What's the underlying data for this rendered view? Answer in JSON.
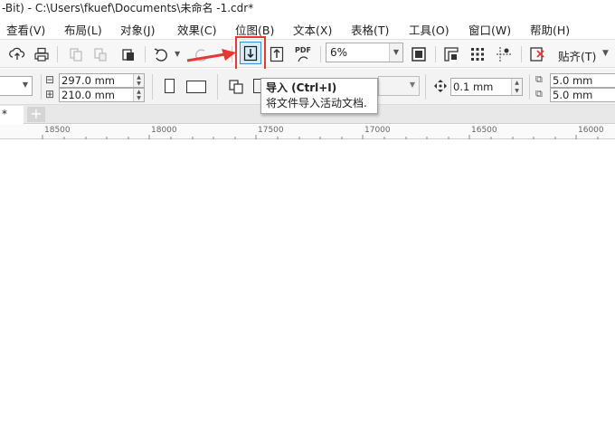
{
  "window": {
    "title": "-Bit) - C:\\Users\\fkuef\\Documents\\未命名 -1.cdr*"
  },
  "menu": {
    "items": [
      "查看(V)",
      "布局(L)",
      "对象(J)",
      "效果(C)",
      "位图(B)",
      "文本(X)",
      "表格(T)",
      "工具(O)",
      "窗口(W)",
      "帮助(H)"
    ]
  },
  "toolbar": {
    "pdf_label": "PDF",
    "zoom_value": "6%",
    "snap_label": "贴齐(T)",
    "icons": [
      "cloud-upload-icon",
      "print-icon",
      "copy-icon",
      "paste-icon",
      "clipboard-icon",
      "undo-icon",
      "redo-icon",
      "import-icon",
      "export-icon",
      "export-pdf-icon",
      "full-screen-icon",
      "rulers-icon",
      "grid-icon",
      "guidelines-icon",
      "options-icon"
    ]
  },
  "property_bar": {
    "width_value": "297.0 mm",
    "height_value": "210.0 mm",
    "nudge_value": "0.1 mm",
    "dup_x_value": "5.0 mm",
    "dup_y_value": "5.0 mm"
  },
  "tooltip": {
    "title": "导入 (Ctrl+I)",
    "description": "将文件导入活动文档."
  },
  "tabs": {
    "active_label": "*",
    "add_label": "+"
  },
  "ruler": {
    "labels": [
      "18500",
      "18000",
      "17500",
      "17000",
      "16500",
      "16000"
    ]
  },
  "colors": {
    "highlight": "#e53935",
    "import_button_bg": "#d6ecfb",
    "accent_blue": "#3a8fd6"
  }
}
